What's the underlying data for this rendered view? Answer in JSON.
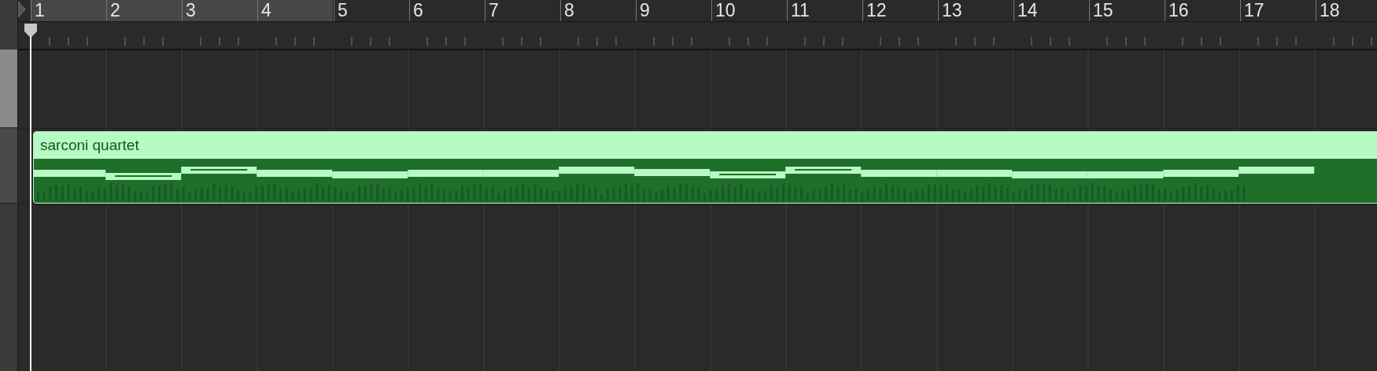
{
  "ruler": {
    "bars": [
      {
        "label": "1",
        "in_cycle": true
      },
      {
        "label": "2",
        "in_cycle": true
      },
      {
        "label": "3",
        "in_cycle": true
      },
      {
        "label": "4",
        "in_cycle": true
      },
      {
        "label": "5",
        "in_cycle": false
      },
      {
        "label": "6",
        "in_cycle": false
      },
      {
        "label": "7",
        "in_cycle": false
      },
      {
        "label": "8",
        "in_cycle": false
      },
      {
        "label": "9",
        "in_cycle": false
      },
      {
        "label": "10",
        "in_cycle": false
      },
      {
        "label": "11",
        "in_cycle": false
      },
      {
        "label": "12",
        "in_cycle": false
      },
      {
        "label": "13",
        "in_cycle": false
      },
      {
        "label": "14",
        "in_cycle": false
      },
      {
        "label": "15",
        "in_cycle": false
      },
      {
        "label": "16",
        "in_cycle": false
      },
      {
        "label": "17",
        "in_cycle": false
      },
      {
        "label": "18",
        "in_cycle": false
      }
    ]
  },
  "tracks": [
    {
      "kind": "empty",
      "selected": true
    },
    {
      "kind": "midi",
      "selected": false,
      "region": {
        "name": "sarconi quartet"
      }
    }
  ]
}
